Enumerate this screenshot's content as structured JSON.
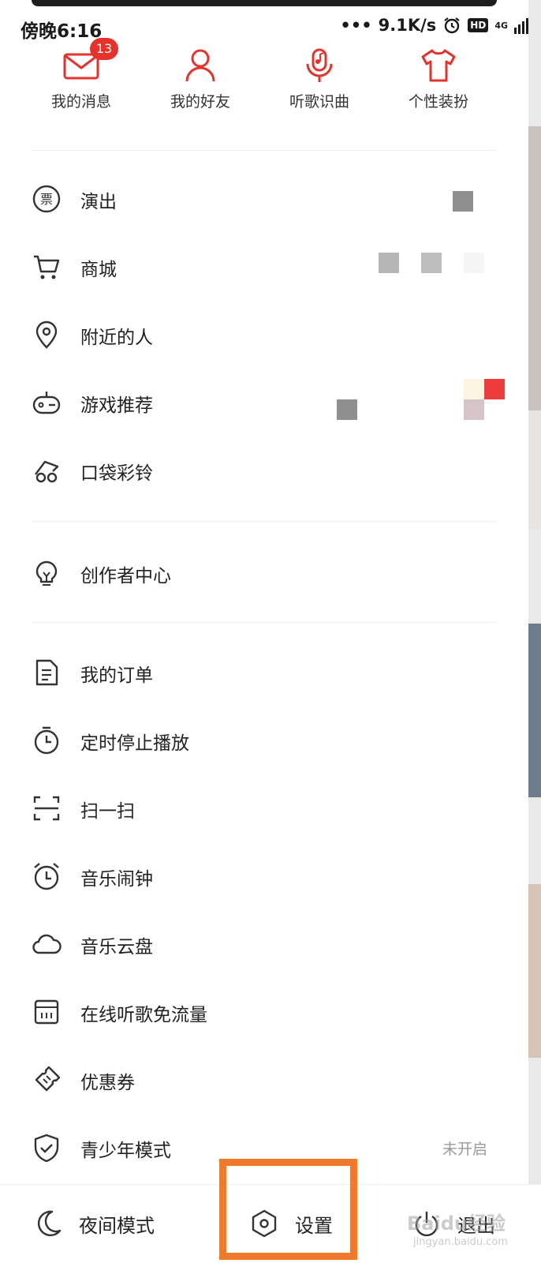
{
  "status_bar": {
    "time": "傍晚6:16",
    "network_speed": "9.1K/s",
    "hd_label": "HD",
    "network_type": "4G"
  },
  "quick_actions": [
    {
      "label": "我的消息",
      "icon": "mail-icon",
      "badge": "13"
    },
    {
      "label": "我的好友",
      "icon": "person-icon"
    },
    {
      "label": "听歌识曲",
      "icon": "mic-music-icon"
    },
    {
      "label": "个性装扮",
      "icon": "tshirt-icon"
    }
  ],
  "menu_group_1": [
    {
      "label": "演出",
      "icon": "ticket-icon"
    },
    {
      "label": "商城",
      "icon": "cart-icon"
    },
    {
      "label": "附近的人",
      "icon": "location-pin-icon"
    },
    {
      "label": "游戏推荐",
      "icon": "gamepad-icon"
    },
    {
      "label": "口袋彩铃",
      "icon": "music-note-icon"
    }
  ],
  "menu_group_2": [
    {
      "label": "创作者中心",
      "icon": "lightbulb-icon"
    }
  ],
  "menu_group_3": [
    {
      "label": "我的订单",
      "icon": "order-doc-icon"
    },
    {
      "label": "定时停止播放",
      "icon": "timer-icon"
    },
    {
      "label": "扫一扫",
      "icon": "scan-icon"
    },
    {
      "label": "音乐闹钟",
      "icon": "alarm-clock-icon"
    },
    {
      "label": "音乐云盘",
      "icon": "cloud-icon"
    },
    {
      "label": "在线听歌免流量",
      "icon": "sim-card-icon"
    },
    {
      "label": "优惠券",
      "icon": "coupon-icon"
    },
    {
      "label": "青少年模式",
      "icon": "shield-check-icon",
      "status": "未开启"
    }
  ],
  "bottom_bar": {
    "night_mode": "夜间模式",
    "settings": "设置",
    "logout": "退出"
  },
  "watermark": {
    "text": "Baidu经验",
    "sub": "jingyan.baidu.com"
  },
  "colors": {
    "accent_red": "#e5322d",
    "highlight_orange": "#f07a2c"
  }
}
